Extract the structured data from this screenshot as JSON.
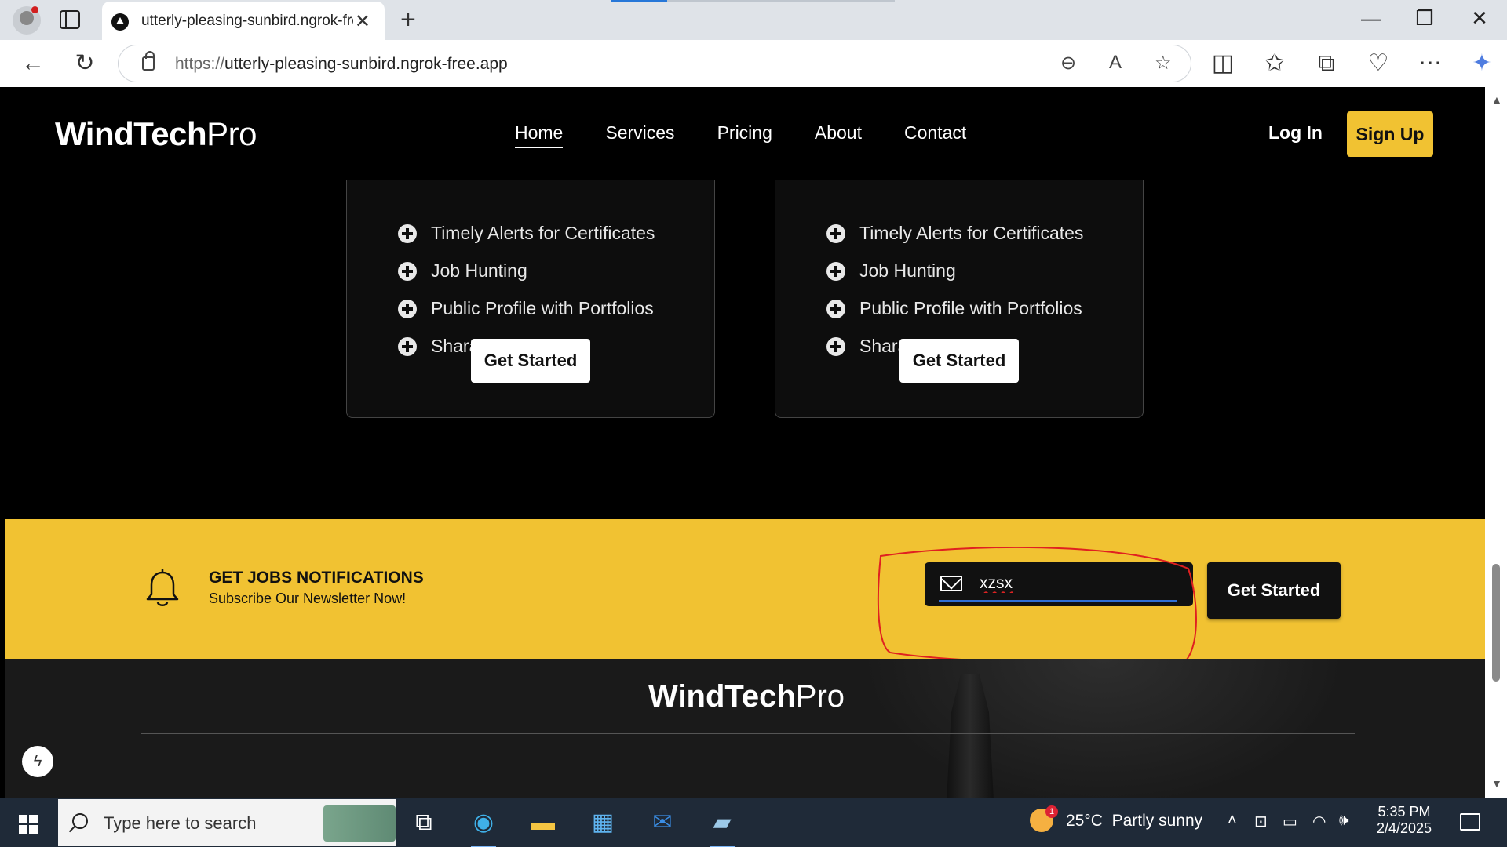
{
  "browser": {
    "tab_title": "utterly-pleasing-sunbird.ngrok-free.app",
    "url_scheme": "https://",
    "url_host": "utterly-pleasing-sunbird.ngrok-free.app",
    "new_tab": "+",
    "close_tab": "✕",
    "minimize": "—",
    "restore": "❐",
    "close_window": "✕",
    "back": "←",
    "refresh": "↻",
    "zoom_icon": "⊖",
    "read_aloud_icon": "A",
    "favorite_icon": "☆",
    "split_icon": "◫",
    "favorites_icon": "✩",
    "collections_icon": "⧉",
    "health_icon": "♡",
    "more_icon": "⋯",
    "copilot_icon": "✦"
  },
  "site": {
    "logo_bold": "WindTech",
    "logo_light": "Pro",
    "nav": [
      "Home",
      "Services",
      "Pricing",
      "About",
      "Contact"
    ],
    "login": "Log In",
    "signup": "Sign Up"
  },
  "plans": [
    {
      "features": [
        "Timely Alerts for Certificates",
        "Job Hunting",
        "Public Profile with Portfolios",
        "Sharable Profile"
      ],
      "button": "Get Started"
    },
    {
      "features": [
        "Timely Alerts for Certificates",
        "Job Hunting",
        "Public Profile with Portfolios",
        "Sharable Profile"
      ],
      "button": "Get Started"
    }
  ],
  "newsletter": {
    "title": "GET JOBS NOTIFICATIONS",
    "subtitle": "Subscribe Our Newsletter Now!",
    "email_value": "xzsx",
    "button": "Get Started",
    "accent_color": "#f1c232",
    "annotation_color": "#e02020"
  },
  "footer": {
    "logo_bold": "WindTech",
    "logo_light": "Pro"
  },
  "taskbar": {
    "search_placeholder": "Type here to search",
    "weather_temp": "25°C",
    "weather_text": "Partly sunny",
    "weather_badge": "1",
    "time": "5:35 PM",
    "date": "2/4/2025"
  }
}
